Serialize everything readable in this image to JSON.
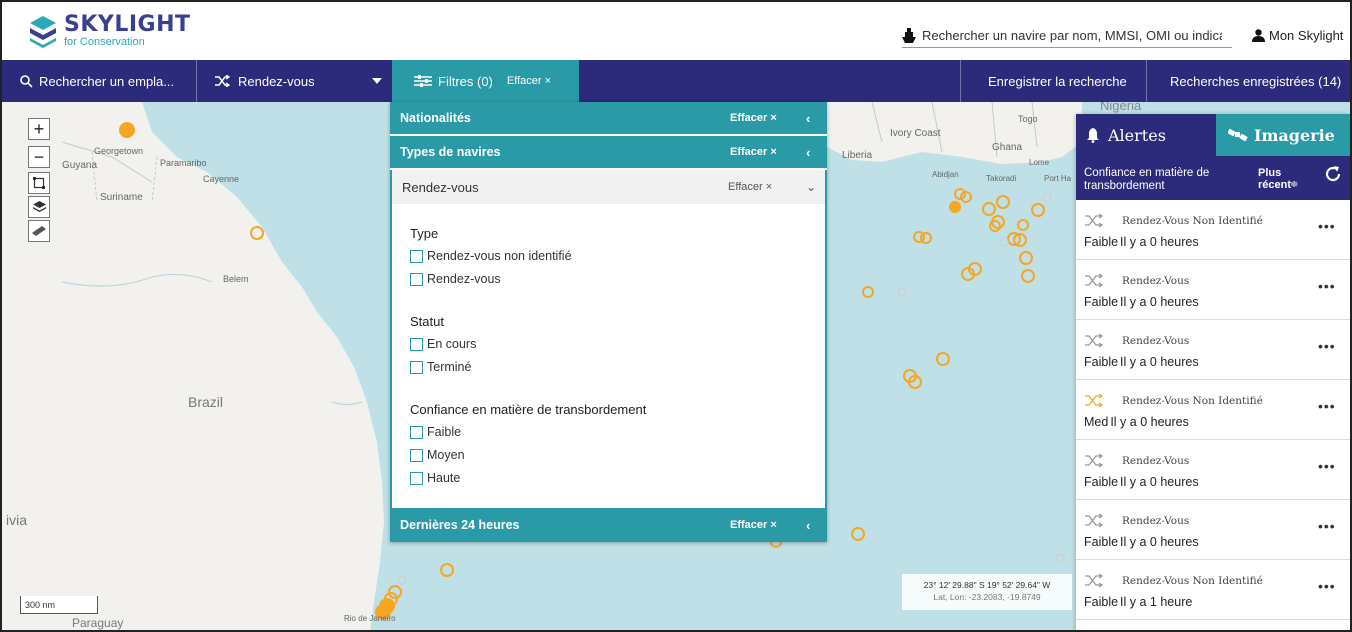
{
  "header": {
    "logo_title": "SKYLIGHT",
    "logo_subtitle": "for Conservation",
    "vessel_search_placeholder": "Rechercher un navire par nom, MMSI, OMI ou indicatif d",
    "account_label": "Mon Skylight"
  },
  "navbar": {
    "location_search": "Rechercher un empla...",
    "event_type": "Rendez-vous",
    "filters_label": "Filtres (0)",
    "filters_clear": "Effacer ×",
    "save_search": "Enregistrer la recherche",
    "saved_searches": "Recherches enregistrées (14)"
  },
  "filter_panel": {
    "sections": [
      {
        "label": "Nationalités",
        "clear": "Effacer ×",
        "chevron": "‹"
      },
      {
        "label": "Types de navires",
        "clear": "Effacer ×",
        "chevron": "‹"
      }
    ],
    "open_section": {
      "label": "Rendez-vous",
      "clear": "Effacer ×",
      "chevron": "⌄"
    },
    "groups": {
      "type": {
        "title": "Type",
        "options": [
          "Rendez-vous non identifié",
          "Rendez-vous"
        ]
      },
      "status": {
        "title": "Statut",
        "options": [
          "En cours",
          "Terminé"
        ]
      },
      "confidence": {
        "title": "Confiance en matière de transbordement",
        "options": [
          "Faible",
          "Moyen",
          "Haute"
        ]
      }
    },
    "time_section": {
      "label": "Dernières 24 heures",
      "clear": "Effacer ×",
      "chevron": "‹"
    }
  },
  "alerts_panel": {
    "tab_alerts": "Alertes",
    "tab_imagery": "Imagerie",
    "sort_label": "Confiance en matière de transbordement",
    "sort_order": "Plus récent",
    "sort_caret": "≑",
    "items": [
      {
        "title": "Rendez-Vous Non Identifié",
        "level": "Faible",
        "time": "Il y a 0 heures",
        "icon_color": "#999999",
        "more": "•••"
      },
      {
        "title": "Rendez-Vous",
        "level": "Faible",
        "time": "Il y a 0 heures",
        "icon_color": "#999999",
        "more": "•••"
      },
      {
        "title": "Rendez-Vous",
        "level": "Faible",
        "time": "Il y a 0 heures",
        "icon_color": "#999999",
        "more": "•••"
      },
      {
        "title": "Rendez-Vous Non Identifié",
        "level": "Med",
        "time": "Il y a 0 heures",
        "icon_color": "#f5a623",
        "more": "•••"
      },
      {
        "title": "Rendez-Vous",
        "level": "Faible",
        "time": "Il y a 0 heures",
        "icon_color": "#999999",
        "more": "•••"
      },
      {
        "title": "Rendez-Vous",
        "level": "Faible",
        "time": "Il y a 0 heures",
        "icon_color": "#999999",
        "more": "•••"
      },
      {
        "title": "Rendez-Vous Non Identifié",
        "level": "Faible",
        "time": "Il y a 1 heure",
        "icon_color": "#999999",
        "more": "•••"
      }
    ]
  },
  "map": {
    "controls": {
      "zoom_in": "+",
      "zoom_out": "−"
    },
    "scale": "300 nm",
    "coords_line1": "23° 12' 29.88\" S 19° 52' 29.64\" W",
    "coords_line2": "Lat, Lon: -23.2083, -19.8749",
    "labels": {
      "guyana": "Guyana",
      "georgetown": "Georgetown",
      "paramaribo": "Paramaribo",
      "suriname": "Suriname",
      "cayenne": "Cayenne",
      "belem": "Belem",
      "brazil": "Brazil",
      "bolivia": "ivia",
      "paraguay": "Paraguay",
      "rio": "Rio de Janeiro",
      "liberia": "Liberia",
      "ivory_coast": "Ivory Coast",
      "ghana": "Ghana",
      "togo": "Togo",
      "nigeria": "Nigeria",
      "abidjan": "Abidjan",
      "takoradi": "Takoradi",
      "lome": "Lome",
      "port_harcourt": "Port Ha"
    },
    "colors": {
      "ocean": "#bfe0e6",
      "land": "#f2f1ee",
      "marker": "#f5a623"
    }
  }
}
